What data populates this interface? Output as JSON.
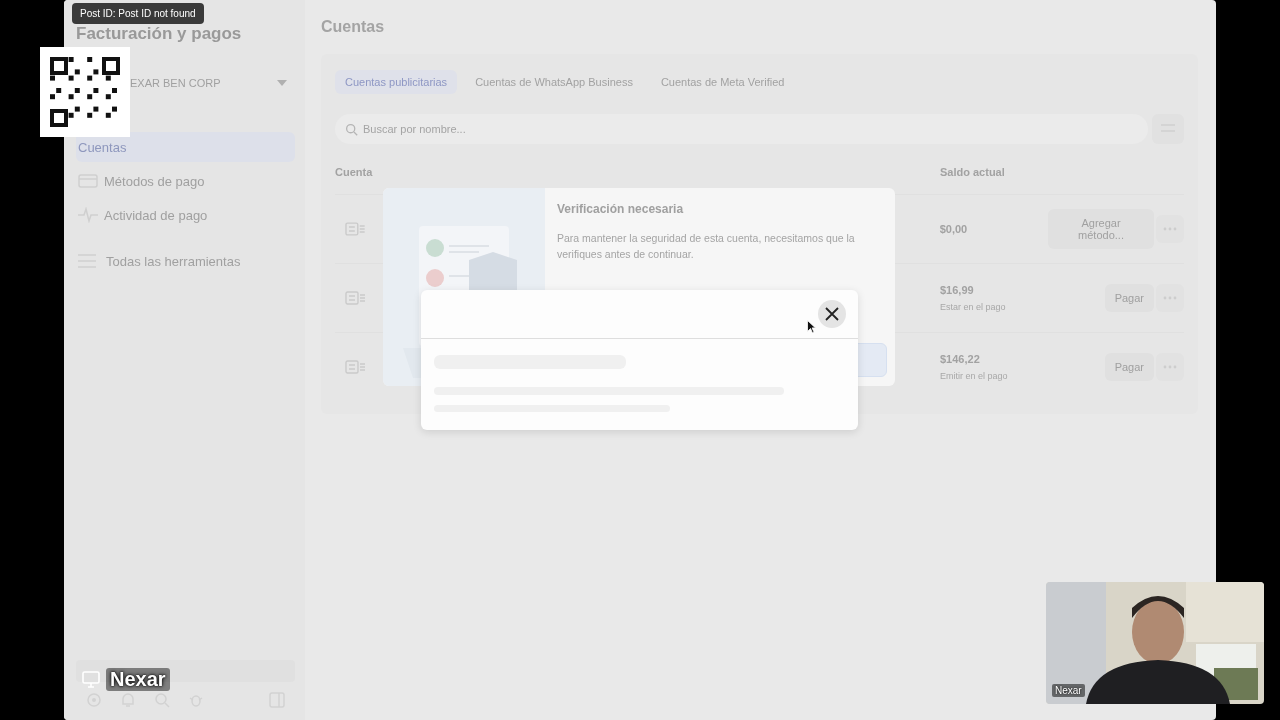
{
  "overlay": {
    "tooltip": "Post ID: Post ID not found",
    "presenter_label": "Nexar",
    "webcam": {
      "kind": "picture",
      "label": "Nexar"
    }
  },
  "sidebar": {
    "title": "Facturación y pagos",
    "account": "EXAR BEN CORP",
    "items": [
      {
        "kind": "plain",
        "label": "Cuentas",
        "selected": true
      },
      {
        "kind": "card",
        "label": "Métodos de pago",
        "selected": false
      },
      {
        "kind": "pulse",
        "label": "Actividad de pago",
        "selected": false
      }
    ],
    "tools": "Todas las herramientas"
  },
  "main": {
    "title": "Cuentas",
    "tabs": [
      {
        "label": "Cuentas publicitarias",
        "selected": true
      },
      {
        "label": "Cuentas de WhatsApp Business",
        "selected": false
      },
      {
        "label": "Cuentas de Meta Verified",
        "selected": false
      }
    ],
    "search": {
      "placeholder": "Buscar por nombre..."
    },
    "columns": [
      "Cuenta",
      "Saldo actual"
    ],
    "rows": [
      {
        "balance": "$0,00",
        "note": null,
        "action": "Agregar método..."
      },
      {
        "balance": "$16,99",
        "note": "Estar en el pago",
        "action": "Pagar"
      },
      {
        "balance": "$146,22",
        "note": "Emitir en el pago",
        "action": "Pagar"
      }
    ]
  },
  "verification": {
    "title": "Verificación necesaria",
    "body": "Para mantener la seguridad de esta cuenta, necesitamos que la verifiques antes de continuar."
  },
  "loading_dialog": {
    "loading": true
  }
}
